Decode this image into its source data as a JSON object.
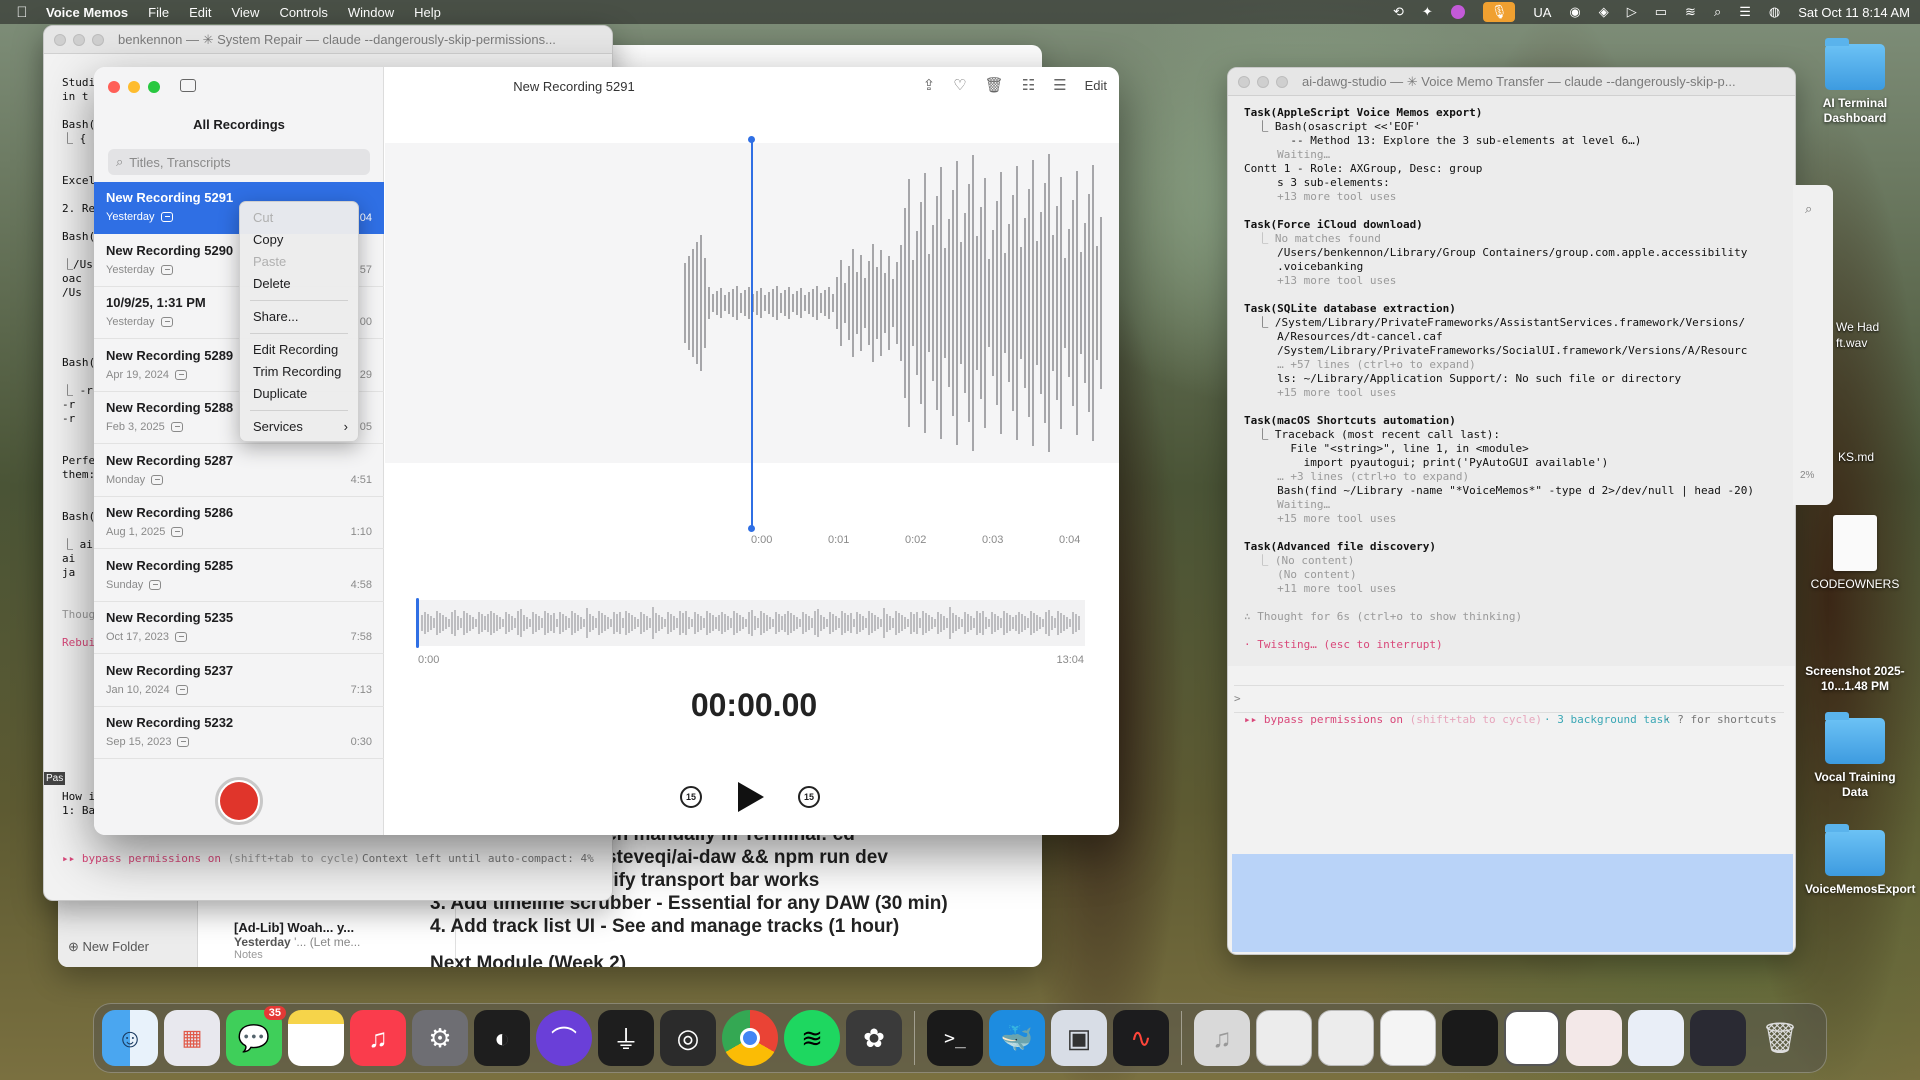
{
  "menubar": {
    "app_name": "Voice Memos",
    "menus": [
      "File",
      "Edit",
      "View",
      "Controls",
      "Window",
      "Help"
    ],
    "input_source": "UA",
    "datetime": "Sat Oct 11  8:14 AM"
  },
  "left_terminal": {
    "title": "benkennon — ✳ System Repair — claude --dangerously-skip-permissions...",
    "fragments": [
      "Studi",
      "in t",
      "Bash(",
      "⎿ {",
      "Excel",
      "2. Re",
      "Bash(",
      "⎿/Us",
      "oac",
      "/Us",
      "Bash(",
      "⎿ -r",
      "-r",
      "-r",
      "Perfe",
      "them:",
      "Bash(",
      "⎿ ai",
      "ai",
      "ja",
      "Thoug",
      "Rebui",
      "How i",
      "1: Ba"
    ],
    "status_mode": "▸▸ bypass permissions on",
    "status_hint": "(shift+tab to cycle)",
    "context": "Context left until auto-compact: 4%",
    "pas_label": "Pas"
  },
  "notes_window": {
    "body_lines": [
      "ch manually in Terminal: cd",
      "steveqi/ai-daw && npm run dev",
      "rify transport bar works",
      "3. Add timeline scrubber - Essential for any DAW (30 min)",
      "4. Add track list UI - See and manage tracks (1 hour)",
      "Next Module (Week 2)"
    ],
    "new_folder": "New Folder",
    "note_title": "[Ad-Lib] Woah... y...",
    "note_date": "Yesterday",
    "note_preview": "'... (Let me...",
    "note_folder": "Notes",
    "sidebar_notes": "Notes"
  },
  "voice_memos": {
    "window_title": "New Recording 5291",
    "sidebar_title": "All Recordings",
    "search_placeholder": "Titles, Transcripts",
    "toolbar_edit": "Edit",
    "recordings": [
      {
        "name": "New Recording 5291",
        "date": "Yesterday",
        "duration": ":04"
      },
      {
        "name": "New Recording 5290",
        "date": "Yesterday",
        "duration": ":57"
      },
      {
        "name": "10/9/25, 1:31 PM",
        "date": "Yesterday",
        "duration": ":00"
      },
      {
        "name": "New Recording 5289",
        "date": "Apr 19, 2024",
        "duration": ":29"
      },
      {
        "name": "New Recording 5288",
        "date": "Feb 3, 2025",
        "duration": ":05"
      },
      {
        "name": "New Recording 5287",
        "date": "Monday",
        "duration": "4:51"
      },
      {
        "name": "New Recording 5286",
        "date": "Aug 1, 2025",
        "duration": "1:10"
      },
      {
        "name": "New Recording 5285",
        "date": "Sunday",
        "duration": "4:58"
      },
      {
        "name": "New Recording 5235",
        "date": "Oct 17, 2023",
        "duration": "7:58"
      },
      {
        "name": "New Recording 5237",
        "date": "Jan 10, 2024",
        "duration": "7:13"
      },
      {
        "name": "New Recording 5232",
        "date": "Sep 15, 2023",
        "duration": "0:30"
      }
    ],
    "time_ticks": [
      "0:00",
      "0:01",
      "0:02",
      "0:03",
      "0:04"
    ],
    "overview_start": "0:00",
    "overview_end": "13:04",
    "current_time": "00:00.00",
    "skip_back_label": "15",
    "skip_forward_label": "15"
  },
  "context_menu": {
    "items": [
      {
        "label": "Cut",
        "enabled": false
      },
      {
        "label": "Copy",
        "enabled": true
      },
      {
        "label": "Paste",
        "enabled": false
      },
      {
        "label": "Delete",
        "enabled": true
      },
      {
        "label": "Share...",
        "enabled": true
      },
      {
        "label": "Edit Recording",
        "enabled": true
      },
      {
        "label": "Trim Recording",
        "enabled": true
      },
      {
        "label": "Duplicate",
        "enabled": true
      },
      {
        "label": "Services",
        "enabled": true
      }
    ]
  },
  "right_terminal": {
    "title": "ai-dawg-studio — ✳ Voice Memo Transfer — claude --dangerously-skip-p...",
    "lines": [
      {
        "t": "Task(AppleScript Voice Memos export)",
        "c": "b"
      },
      {
        "t": "  ⎿ Bash(osascript <<'EOF'",
        "c": ""
      },
      {
        "t": "       -- Method 13: Explore the 3 sub-elements at level 6…)",
        "c": ""
      },
      {
        "t": "     Waiting…",
        "c": "dim"
      },
      {
        "t": "Contt 1 - Role: AXGroup, Desc: group",
        "c": ""
      },
      {
        "t": "     s 3 sub-elements:",
        "c": ""
      },
      {
        "t": "     +13 more tool uses",
        "c": "dim"
      },
      {
        "t": "",
        "c": ""
      },
      {
        "t": "Task(Force iCloud download)",
        "c": "b"
      },
      {
        "t": "  ⎿ No matches found",
        "c": "dim"
      },
      {
        "t": "     /Users/benkennon/Library/Group Containers/group.com.apple.accessibility",
        "c": ""
      },
      {
        "t": "     .voicebanking",
        "c": ""
      },
      {
        "t": "     +13 more tool uses",
        "c": "dim"
      },
      {
        "t": "",
        "c": ""
      },
      {
        "t": "Task(SQLite database extraction)",
        "c": "b"
      },
      {
        "t": "  ⎿ /System/Library/PrivateFrameworks/AssistantServices.framework/Versions/",
        "c": ""
      },
      {
        "t": "     A/Resources/dt-cancel.caf",
        "c": ""
      },
      {
        "t": "     /System/Library/PrivateFrameworks/SocialUI.framework/Versions/A/Resourc",
        "c": ""
      },
      {
        "t": "     … +57 lines (ctrl+o to expand)",
        "c": "dim"
      },
      {
        "t": "     ls: ~/Library/Application Support/: No such file or directory",
        "c": ""
      },
      {
        "t": "     +15 more tool uses",
        "c": "dim"
      },
      {
        "t": "",
        "c": ""
      },
      {
        "t": "Task(macOS Shortcuts automation)",
        "c": "b"
      },
      {
        "t": "  ⎿ Traceback (most recent call last):",
        "c": ""
      },
      {
        "t": "       File \"<string>\", line 1, in <module>",
        "c": ""
      },
      {
        "t": "         import pyautogui; print('PyAutoGUI available')",
        "c": ""
      },
      {
        "t": "     … +3 lines (ctrl+o to expand)",
        "c": "dim"
      },
      {
        "t": "     Bash(find ~/Library -name \"*VoiceMemos*\" -type d 2>/dev/null | head -20)",
        "c": ""
      },
      {
        "t": "     Waiting…",
        "c": "dim"
      },
      {
        "t": "     +15 more tool uses",
        "c": "dim"
      },
      {
        "t": "",
        "c": ""
      },
      {
        "t": "Task(Advanced file discovery)",
        "c": "b"
      },
      {
        "t": "  ⎿ (No content)",
        "c": "dim"
      },
      {
        "t": "     (No content)",
        "c": "dim"
      },
      {
        "t": "     +11 more tool uses",
        "c": "dim"
      },
      {
        "t": "",
        "c": ""
      },
      {
        "t": "∴ Thought for 6s (ctrl+o to show thinking)",
        "c": "dim"
      },
      {
        "t": "",
        "c": ""
      },
      {
        "t": "· Twisting… (esc to interrupt)",
        "c": "pink"
      }
    ],
    "prompt": ">",
    "status_mode": "▸▸ bypass permissions on",
    "status_hint": "(shift+tab to cycle)",
    "background_task": "· 3 background task",
    "shortcuts": "· ? for shortcuts"
  },
  "finder_partial": {
    "items": [
      "We Had",
      "ft.wav",
      "KS.md",
      "2%"
    ]
  },
  "desktop_icons": [
    {
      "label": "AI Terminal Dashboard",
      "kind": "folder"
    },
    {
      "label": "CODEOWNERS",
      "kind": "doc"
    },
    {
      "label": "Screenshot 2025-10...1.48 PM",
      "kind": "image"
    },
    {
      "label": "Vocal Training Data",
      "kind": "folder"
    },
    {
      "label": "VoiceMemosExport",
      "kind": "folder"
    }
  ],
  "dock": {
    "messages_badge": "35",
    "apps": [
      "Finder",
      "Launchpad",
      "Messages",
      "Notes",
      "Music",
      "System Settings",
      "Universal Audio",
      "Arc",
      "UA Connect",
      "Compressor",
      "Chrome",
      "Spotify",
      "ChatGPT",
      "Terminal",
      "Docker",
      "Preview",
      "Voice Memos"
    ]
  },
  "colors": {
    "accent": "#2f6fe4",
    "record": "#e0352b",
    "playhead": "#2f6fe4"
  }
}
